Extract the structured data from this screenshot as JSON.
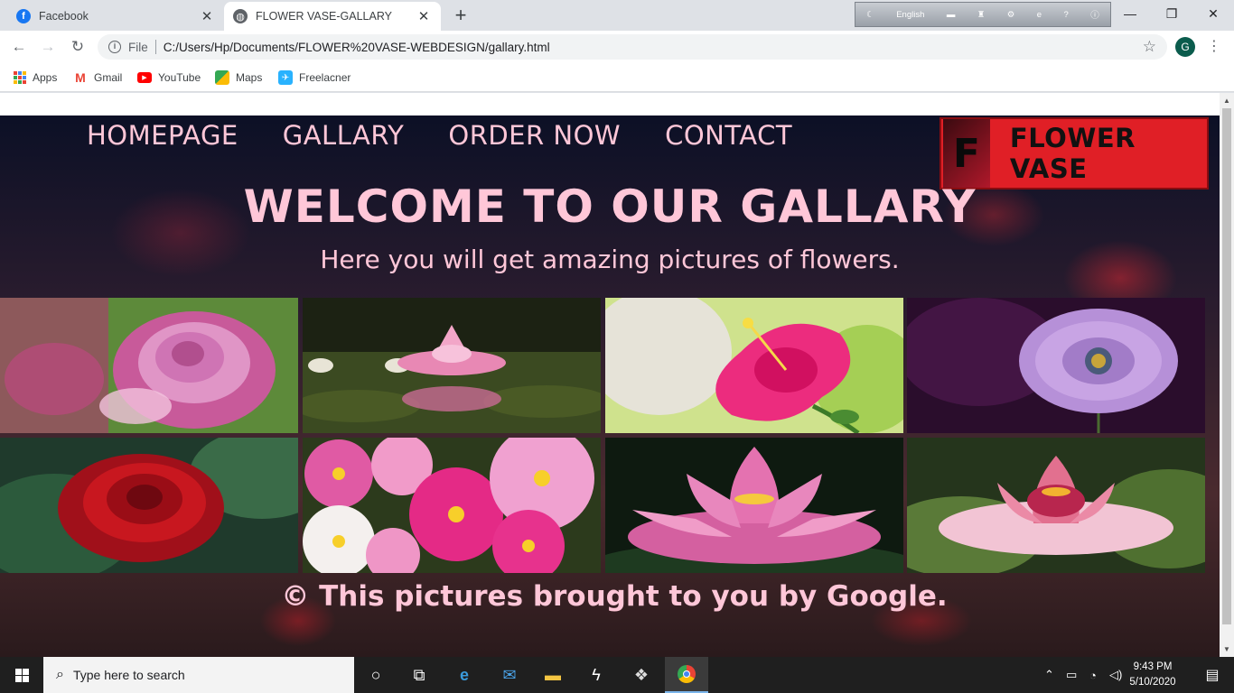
{
  "browser": {
    "tabs": [
      {
        "title": "Facebook",
        "favicon": "facebook-icon",
        "active": false
      },
      {
        "title": "FLOWER VASE-GALLARY",
        "favicon": "globe-icon",
        "active": true
      }
    ],
    "language_bar": {
      "language": "English"
    },
    "address": {
      "scheme": "File",
      "url": "C:/Users/Hp/Documents/FLOWER%20VASE-WEBDESIGN/gallary.html"
    },
    "profile_initial": "G",
    "bookmarks": [
      {
        "label": "Apps",
        "icon": "apps-grid-icon"
      },
      {
        "label": "Gmail",
        "icon": "gmail-icon"
      },
      {
        "label": "YouTube",
        "icon": "youtube-icon"
      },
      {
        "label": "Maps",
        "icon": "maps-icon"
      },
      {
        "label": "Freelacner",
        "icon": "freelancer-icon"
      }
    ]
  },
  "site": {
    "nav": [
      "HOMEPAGE",
      "GALLARY",
      "ORDER NOW",
      "CONTACT"
    ],
    "logo": {
      "letter": "F",
      "name": "FLOWER VASE"
    },
    "hero_title": "WELCOME TO OUR GALLARY",
    "hero_subtitle": "Here you will get amazing pictures of flowers.",
    "gallery": [
      {
        "subject": "pink-rose"
      },
      {
        "subject": "pink-water-lily"
      },
      {
        "subject": "pink-hibiscus"
      },
      {
        "subject": "purple-daisy"
      },
      {
        "subject": "red-rose"
      },
      {
        "subject": "cosmos-flowers"
      },
      {
        "subject": "pink-lotus"
      },
      {
        "subject": "pink-water-lily-on-pads"
      }
    ],
    "footer_note": "© This pictures brought to you by Google.",
    "colors": {
      "text_accent": "#ffc7d8",
      "logo_bg": "#e01f26"
    }
  },
  "taskbar": {
    "search_placeholder": "Type here to search",
    "time": "9:43 PM",
    "date": "5/10/2020"
  }
}
